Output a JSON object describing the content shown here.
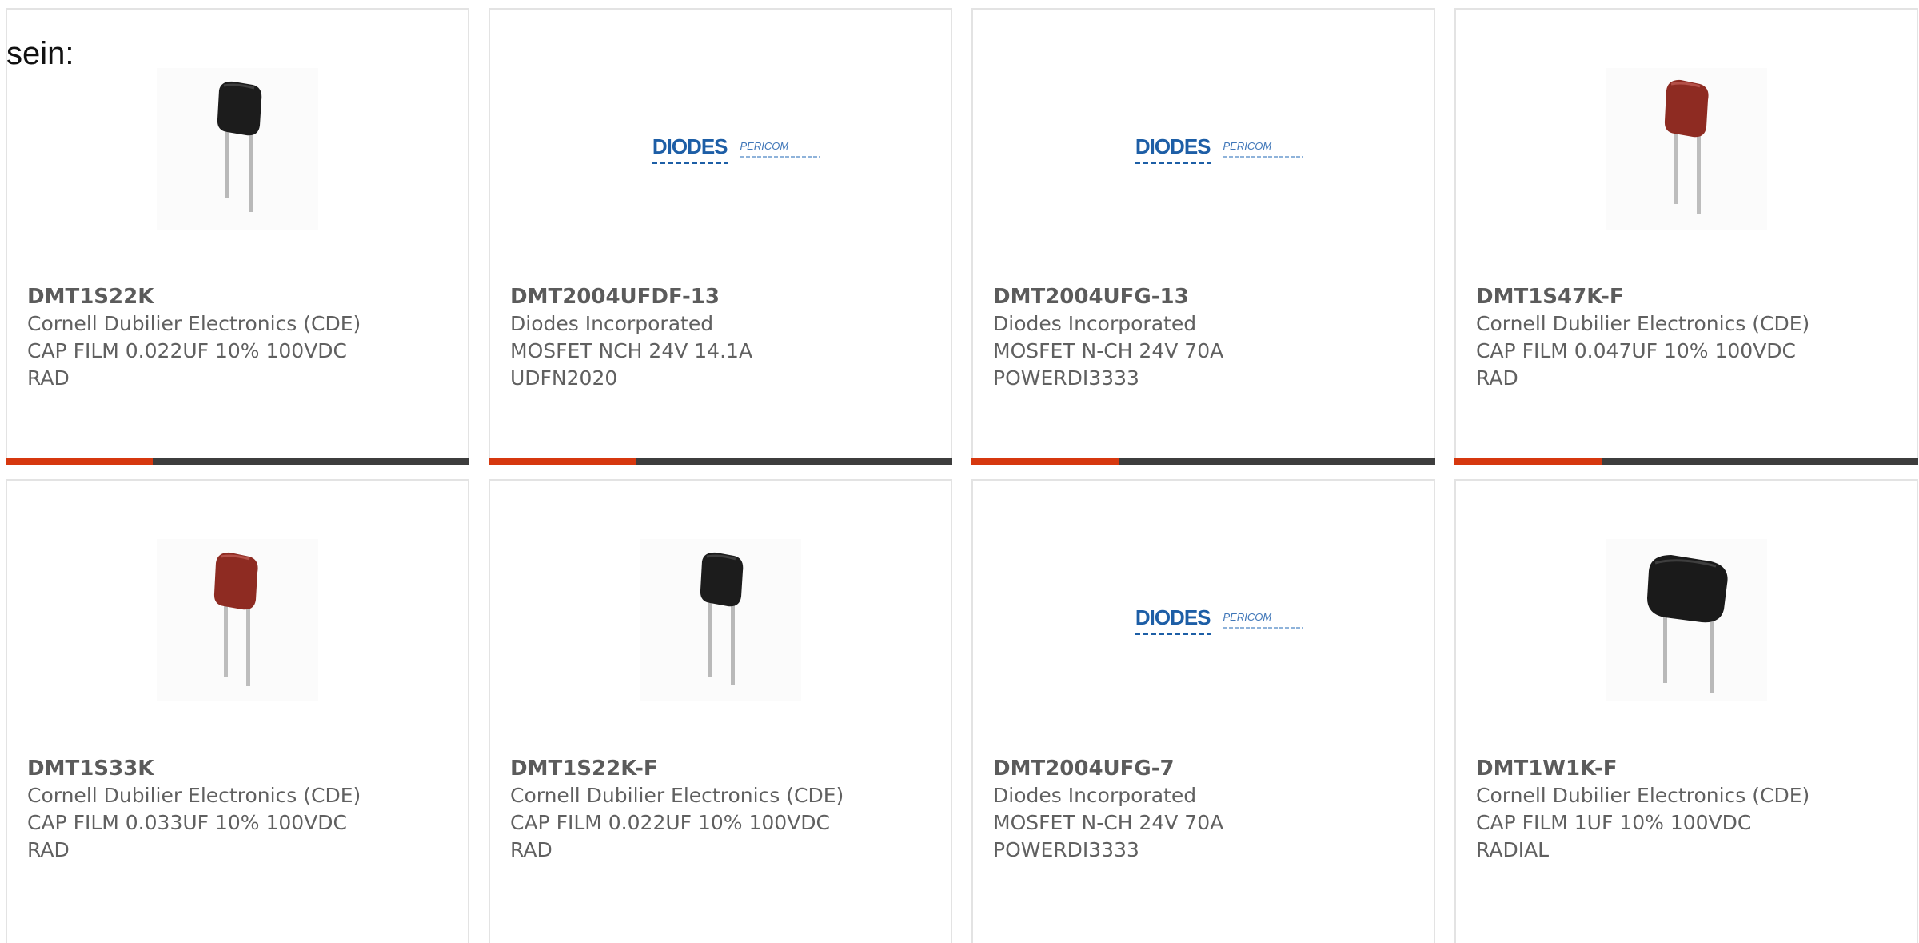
{
  "intro_text": "sein:",
  "colors": {
    "accent": "#d6380f",
    "bar": "#3d3d3d",
    "border": "#e3e3e3",
    "text": "#606060",
    "logo_blue": "#1d5ea6"
  },
  "logo": {
    "diodes": "DIODES",
    "pericom": "PERICOM"
  },
  "products": [
    {
      "part_number": "DMT1S22K",
      "manufacturer": "Cornell Dubilier Electronics (CDE)",
      "desc_line1": "CAP FILM 0.022UF 10% 100VDC",
      "desc_line2": "RAD",
      "image": "black-film-capacitor"
    },
    {
      "part_number": "DMT2004UFDF-13",
      "manufacturer": "Diodes Incorporated",
      "desc_line1": "MOSFET NCH 24V 14.1A",
      "desc_line2": "UDFN2020",
      "image": "diodes-logo"
    },
    {
      "part_number": "DMT2004UFG-13",
      "manufacturer": "Diodes Incorporated",
      "desc_line1": "MOSFET N-CH 24V 70A",
      "desc_line2": "POWERDI3333",
      "image": "diodes-logo"
    },
    {
      "part_number": "DMT1S47K-F",
      "manufacturer": "Cornell Dubilier Electronics (CDE)",
      "desc_line1": "CAP FILM 0.047UF 10% 100VDC",
      "desc_line2": "RAD",
      "image": "red-film-capacitor"
    },
    {
      "part_number": "DMT1S33K",
      "manufacturer": "Cornell Dubilier Electronics (CDE)",
      "desc_line1": "CAP FILM 0.033UF 10% 100VDC",
      "desc_line2": "RAD",
      "image": "red-film-capacitor"
    },
    {
      "part_number": "DMT1S22K-F",
      "manufacturer": "Cornell Dubilier Electronics (CDE)",
      "desc_line1": "CAP FILM 0.022UF 10% 100VDC",
      "desc_line2": "RAD",
      "image": "black-film-capacitor"
    },
    {
      "part_number": "DMT2004UFG-7",
      "manufacturer": "Diodes Incorporated",
      "desc_line1": "MOSFET N-CH 24V 70A",
      "desc_line2": "POWERDI3333",
      "image": "diodes-logo"
    },
    {
      "part_number": "DMT1W1K-F",
      "manufacturer": "Cornell Dubilier Electronics (CDE)",
      "desc_line1": "CAP FILM 1UF 10% 100VDC",
      "desc_line2": "RADIAL",
      "image": "large-black-film-capacitor"
    }
  ]
}
